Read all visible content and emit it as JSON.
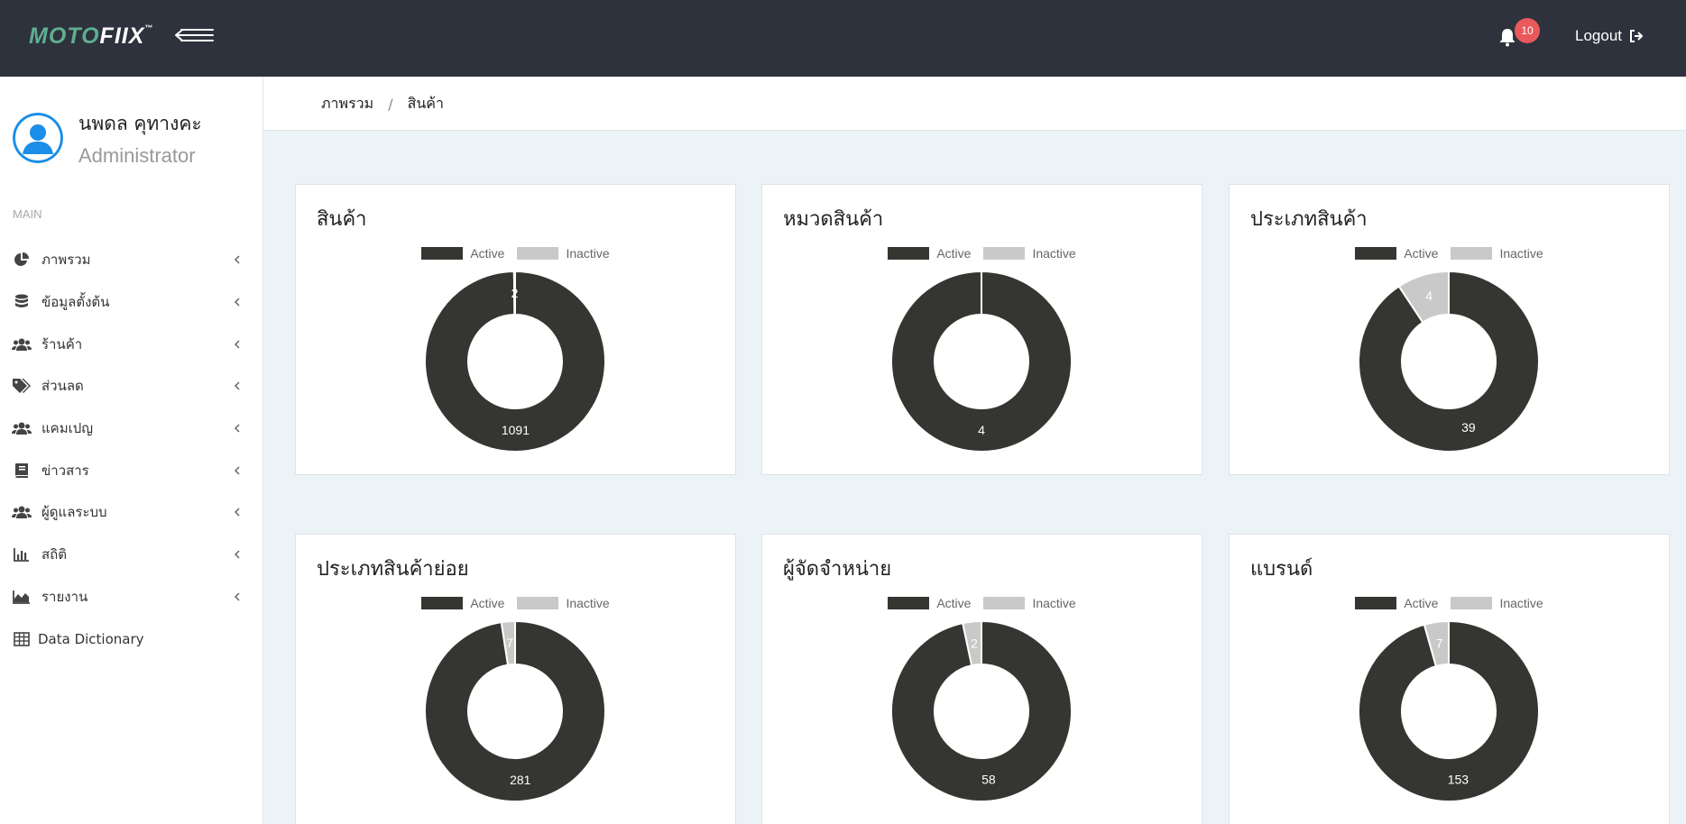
{
  "app": {
    "logo_part1": "MOTO",
    "logo_part2": "FIIX",
    "logo_tm": "™",
    "notification_count": "10",
    "logout_label": "Logout"
  },
  "colors": {
    "topbar": "#2e323d",
    "brand_green": "#5fae8f",
    "active": "#353631",
    "inactive": "#c9c9c9",
    "badge": "#e9585b",
    "avatar": "#1a8ee8"
  },
  "user": {
    "name": "นพดล คุทางคะ",
    "role": "Administrator"
  },
  "sidebar": {
    "section_label": "MAIN",
    "items": [
      {
        "label": "ภาพรวม",
        "icon": "pie-chart-icon",
        "has_submenu": true
      },
      {
        "label": "ข้อมูลตั้งต้น",
        "icon": "database-icon",
        "has_submenu": true
      },
      {
        "label": "ร้านค้า",
        "icon": "users-icon",
        "has_submenu": true
      },
      {
        "label": "ส่วนลด",
        "icon": "tags-icon",
        "has_submenu": true
      },
      {
        "label": "แคมเปญ",
        "icon": "users-icon",
        "has_submenu": true
      },
      {
        "label": "ข่าวสาร",
        "icon": "book-icon",
        "has_submenu": true
      },
      {
        "label": "ผู้ดูแลระบบ",
        "icon": "users-icon",
        "has_submenu": true
      },
      {
        "label": "สถิติ",
        "icon": "bar-chart-icon",
        "has_submenu": true
      },
      {
        "label": "รายงาน",
        "icon": "area-chart-icon",
        "has_submenu": true
      },
      {
        "label": "Data Dictionary",
        "icon": "table-icon",
        "has_submenu": false
      }
    ]
  },
  "breadcrumb": {
    "items": [
      "ภาพรวม",
      "สินค้า"
    ],
    "separator": "/"
  },
  "chart_data": [
    {
      "type": "pie",
      "title": "สินค้า",
      "legend": [
        "Active",
        "Inactive"
      ],
      "values": {
        "Active": 1091,
        "Inactive": 2
      },
      "labels": {
        "Active": "1091",
        "Inactive": "2"
      }
    },
    {
      "type": "pie",
      "title": "หมวดสินค้า",
      "legend": [
        "Active",
        "Inactive"
      ],
      "values": {
        "Active": 4,
        "Inactive": 0
      },
      "labels": {
        "Active": "4",
        "Inactive": ""
      }
    },
    {
      "type": "pie",
      "title": "ประเภทสินค้า",
      "legend": [
        "Active",
        "Inactive"
      ],
      "values": {
        "Active": 39,
        "Inactive": 4
      },
      "labels": {
        "Active": "39",
        "Inactive": "4"
      }
    },
    {
      "type": "pie",
      "title": "ประเภทสินค้าย่อย",
      "legend": [
        "Active",
        "Inactive"
      ],
      "values": {
        "Active": 281,
        "Inactive": 7
      },
      "labels": {
        "Active": "281",
        "Inactive": "7"
      }
    },
    {
      "type": "pie",
      "title": "ผู้จัดจำหน่าย",
      "legend": [
        "Active",
        "Inactive"
      ],
      "values": {
        "Active": 58,
        "Inactive": 2
      },
      "labels": {
        "Active": "58",
        "Inactive": "2"
      }
    },
    {
      "type": "pie",
      "title": "แบรนด์",
      "legend": [
        "Active",
        "Inactive"
      ],
      "values": {
        "Active": 153,
        "Inactive": 7
      },
      "labels": {
        "Active": "153",
        "Inactive": "7"
      }
    }
  ]
}
